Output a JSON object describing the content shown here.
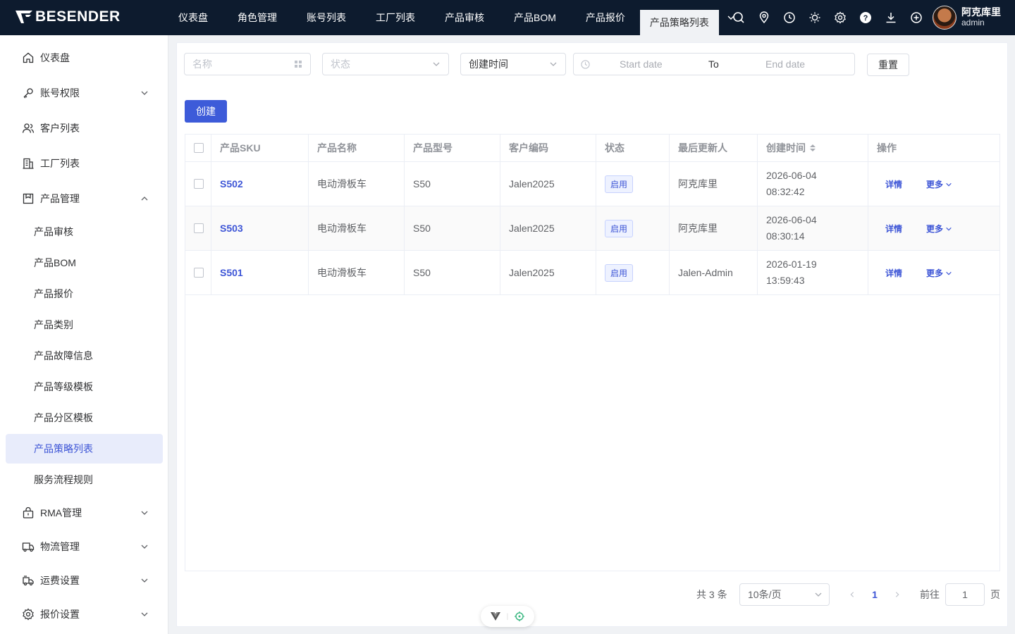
{
  "app": {
    "logo_text": "BESENDER"
  },
  "topnav": {
    "tabs": [
      {
        "label": "仪表盘"
      },
      {
        "label": "角色管理"
      },
      {
        "label": "账号列表"
      },
      {
        "label": "工厂列表"
      },
      {
        "label": "产品审核"
      },
      {
        "label": "产品BOM"
      },
      {
        "label": "产品报价"
      },
      {
        "label": "产品策略列表",
        "active": true
      }
    ],
    "icons": [
      "search-icon",
      "location-icon",
      "clock-icon",
      "sun-icon",
      "gear-icon",
      "help-icon",
      "download-icon",
      "plus-circle-icon"
    ]
  },
  "user": {
    "name": "阿克库里",
    "role": "admin"
  },
  "sidebar": {
    "items": [
      {
        "label": "仪表盘",
        "icon": "home-icon"
      },
      {
        "label": "账号权限",
        "icon": "key-icon",
        "arrow": "down"
      },
      {
        "label": "客户列表",
        "icon": "users-icon"
      },
      {
        "label": "工厂列表",
        "icon": "building-icon"
      },
      {
        "label": "产品管理",
        "icon": "box-icon",
        "arrow": "up"
      },
      {
        "label": "产品审核"
      },
      {
        "label": "产品BOM"
      },
      {
        "label": "产品报价"
      },
      {
        "label": "产品类别"
      },
      {
        "label": "产品故障信息"
      },
      {
        "label": "产品等级模板"
      },
      {
        "label": "产品分区模板"
      },
      {
        "label": "产品策略列表",
        "active": true
      },
      {
        "label": "服务流程规则"
      },
      {
        "label": "RMA管理",
        "icon": "lock-bag-icon",
        "arrow": "down"
      },
      {
        "label": "物流管理",
        "icon": "truck-icon",
        "arrow": "down"
      },
      {
        "label": "运费设置",
        "icon": "freight-icon",
        "arrow": "down"
      },
      {
        "label": "报价设置",
        "icon": "settings-icon",
        "arrow": "down"
      }
    ]
  },
  "filters": {
    "name_placeholder": "名称",
    "status_placeholder": "状态",
    "date_type_value": "创建时间",
    "start_placeholder": "Start date",
    "range_separator": "To",
    "end_placeholder": "End date",
    "reset_label": "重置",
    "create_label": "创建"
  },
  "table": {
    "columns": [
      "产品SKU",
      "产品名称",
      "产品型号",
      "客户编码",
      "状态",
      "最后更新人",
      "创建时间",
      "操作"
    ],
    "rows": [
      {
        "sku": "S502",
        "name": "电动滑板车",
        "model": "S50",
        "customer": "Jalen2025",
        "status": "启用",
        "updater": "阿克库里",
        "date": "2026-06-04",
        "time": "08:32:42",
        "detail": "详情",
        "more": "更多"
      },
      {
        "sku": "S503",
        "name": "电动滑板车",
        "model": "S50",
        "customer": "Jalen2025",
        "status": "启用",
        "updater": "阿克库里",
        "date": "2026-06-04",
        "time": "08:30:14",
        "detail": "详情",
        "more": "更多"
      },
      {
        "sku": "S501",
        "name": "电动滑板车",
        "model": "S50",
        "customer": "Jalen2025",
        "status": "启用",
        "updater": "Jalen-Admin",
        "date": "2026-01-19",
        "time": "13:59:43",
        "detail": "详情",
        "more": "更多"
      }
    ]
  },
  "pagination": {
    "total_text": "共 3 条",
    "page_size": "10条/页",
    "current_page": "1",
    "goto_label": "前往",
    "goto_value": "1",
    "page_suffix": "页"
  },
  "colors": {
    "topbar": "#0d1b2e",
    "accent": "#3d5bd9",
    "active_bg": "#e8ecfb"
  }
}
